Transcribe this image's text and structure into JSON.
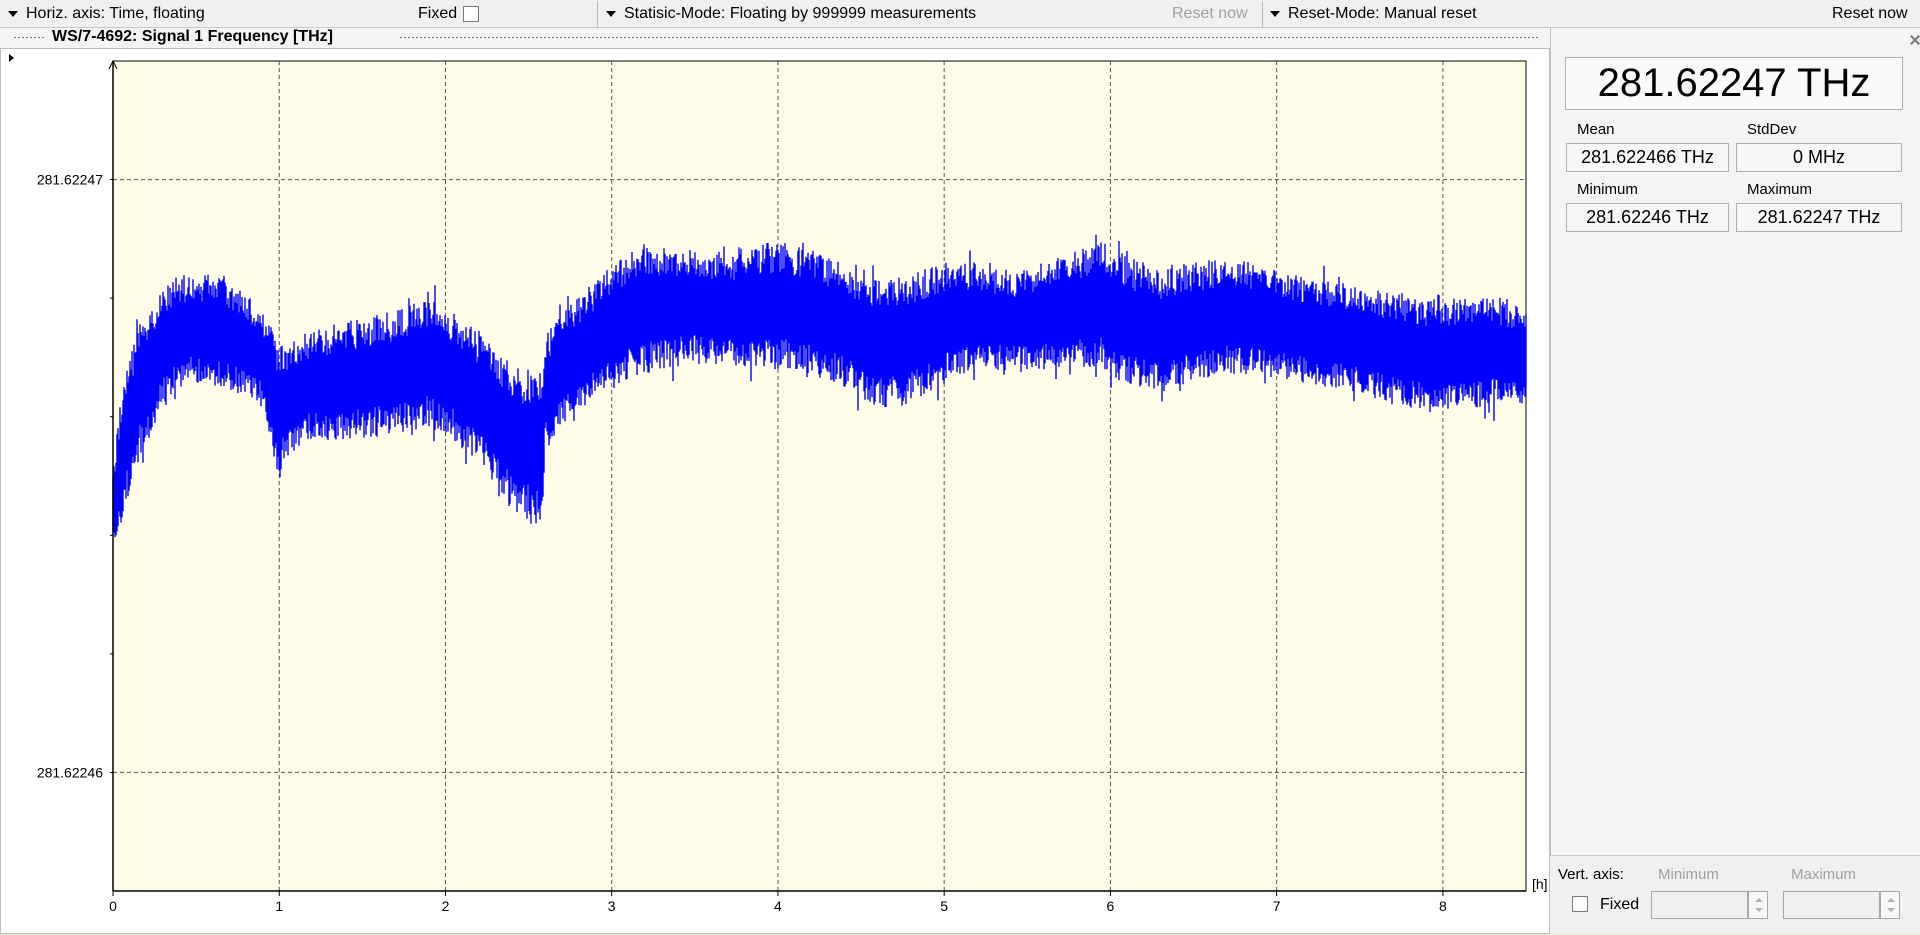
{
  "toolbar": {
    "horiz_axis_label": "Horiz. axis: Time,  floating",
    "fixed_label": "Fixed",
    "statistic_mode_label": "Statisic-Mode: Floating by 999999 measurements",
    "reset_now_disabled_label": "Reset now",
    "reset_mode_label": "Reset-Mode: Manual reset",
    "reset_now_label": "Reset now"
  },
  "panel_title": "WS/7-4692: Signal 1  Frequency  [THz]",
  "readout": {
    "current": "281.62247 THz",
    "mean_label": "Mean",
    "mean_value": "281.622466 THz",
    "stddev_label": "StdDev",
    "stddev_value": "0 MHz",
    "minimum_label": "Minimum",
    "minimum_value": "281.62246 THz",
    "maximum_label": "Maximum",
    "maximum_value": "281.62247 THz"
  },
  "vert_axis": {
    "label": "Vert. axis:",
    "fixed_label": "Fixed",
    "minimum_label": "Minimum",
    "maximum_label": "Maximum"
  },
  "colors": {
    "plot_background": "#fffde8",
    "series": "#0000ff",
    "grid": "#555555"
  },
  "chart_data": {
    "type": "line",
    "xlabel": "[h]",
    "ylabel": "",
    "xlim": [
      0,
      8.5
    ],
    "ylim": [
      281.622458,
      281.622472
    ],
    "x_ticks": [
      "0",
      "1",
      "2",
      "3",
      "4",
      "5",
      "6",
      "7",
      "8"
    ],
    "y_ticks": [
      "281.62247",
      "281.62246"
    ],
    "y_tick_values": [
      281.62247,
      281.62246
    ],
    "grid": true,
    "series": [
      {
        "band": true,
        "x": [
          0,
          0.05,
          0.15,
          0.3,
          0.45,
          0.6,
          0.75,
          0.9,
          1.0,
          1.02,
          1.15,
          1.4,
          1.7,
          1.9,
          2.05,
          2.2,
          2.35,
          2.5,
          2.58,
          2.6,
          2.7,
          2.9,
          3.1,
          3.3,
          3.5,
          3.8,
          4.0,
          4.2,
          4.4,
          4.6,
          4.8,
          5.0,
          5.2,
          5.4,
          5.6,
          5.8,
          5.95,
          6.1,
          6.3,
          6.5,
          6.7,
          6.9,
          7.1,
          7.3,
          7.5,
          7.7,
          7.9,
          8.1,
          8.3,
          8.5
        ],
        "high": [
          281.622465,
          281.6224665,
          281.6224676,
          281.6224682,
          281.6224684,
          281.6224684,
          281.6224682,
          281.6224678,
          281.6224672,
          281.6224672,
          281.6224674,
          281.6224676,
          281.6224678,
          281.622468,
          281.6224678,
          281.6224674,
          281.622467,
          281.6224668,
          281.6224668,
          281.6224674,
          281.6224678,
          281.6224683,
          281.6224688,
          281.6224689,
          281.6224688,
          281.6224688,
          281.622469,
          281.6224688,
          281.6224686,
          281.6224683,
          281.6224684,
          281.6224686,
          281.6224686,
          281.6224684,
          281.6224686,
          281.6224688,
          281.622469,
          281.6224687,
          281.6224685,
          281.6224686,
          281.6224687,
          281.6224686,
          281.6224684,
          281.6224683,
          281.6224682,
          281.6224681,
          281.622468,
          281.622468,
          281.622468,
          281.6224678
        ],
        "low": [
          281.6224638,
          281.6224642,
          281.6224652,
          281.6224662,
          281.6224666,
          281.6224665,
          281.6224664,
          281.6224662,
          281.6224648,
          281.6224652,
          281.6224656,
          281.6224656,
          281.6224657,
          281.6224658,
          281.6224656,
          281.6224652,
          281.6224646,
          281.6224642,
          281.622464,
          281.6224654,
          281.6224658,
          281.6224663,
          281.6224666,
          281.6224668,
          281.6224669,
          281.6224668,
          281.6224668,
          281.6224667,
          281.6224665,
          281.6224661,
          281.6224662,
          281.6224666,
          281.6224668,
          281.6224668,
          281.6224668,
          281.6224668,
          281.6224668,
          281.6224665,
          281.6224664,
          281.6224666,
          281.6224667,
          281.6224667,
          281.6224666,
          281.6224665,
          281.6224664,
          281.6224662,
          281.6224661,
          281.6224661,
          281.6224662,
          281.6224662
        ]
      }
    ]
  }
}
